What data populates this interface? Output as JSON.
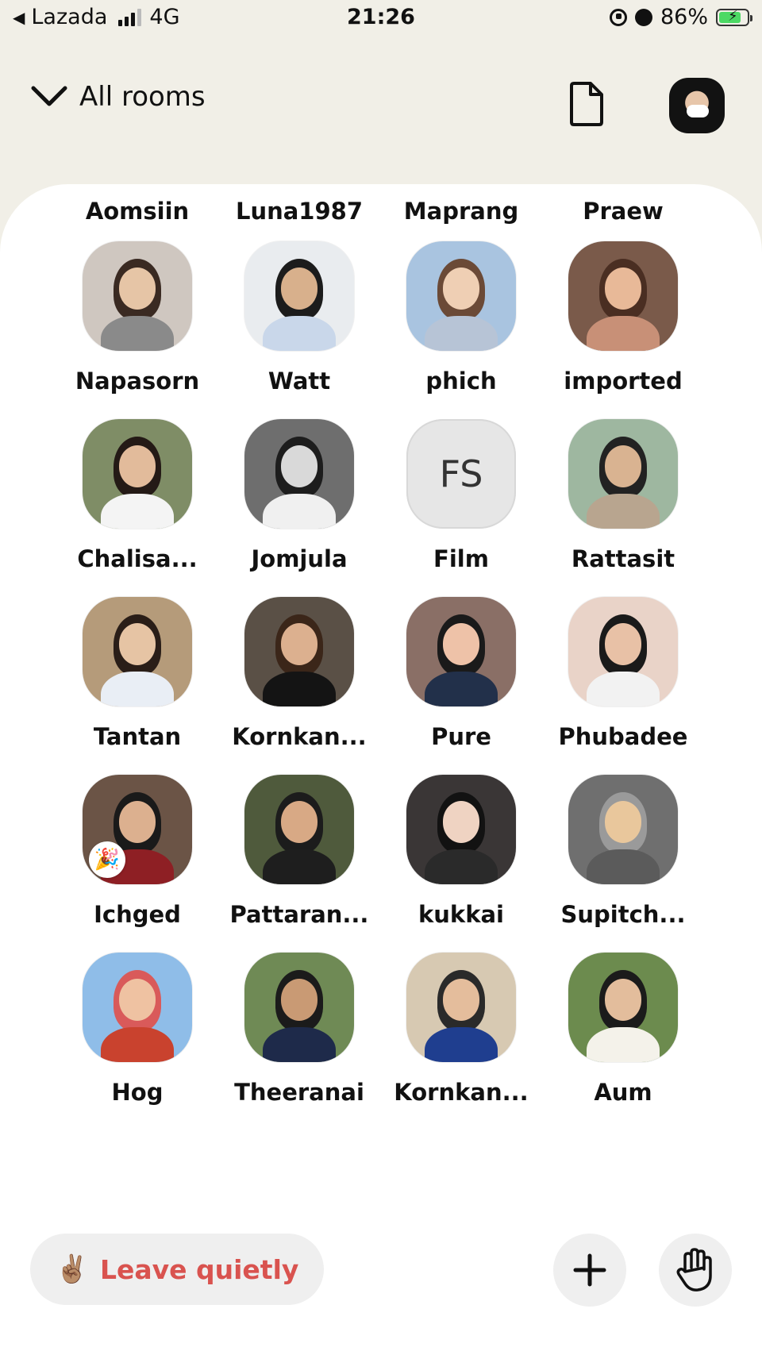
{
  "status_bar": {
    "carrier": "Lazada",
    "network": "4G",
    "time": "21:26",
    "battery": "86%"
  },
  "header": {
    "rooms_label": "All rooms"
  },
  "top_names": [
    "Aomsiin",
    "Luna1987",
    "Maprang",
    "Praew"
  ],
  "participants": [
    {
      "name": "Napasorn",
      "bg": "#cfc7c0",
      "skin": "#e6c5a6",
      "hair": "#3a2a22",
      "shirt": "#8a8a8a"
    },
    {
      "name": "Watt",
      "bg": "#e9ecef",
      "skin": "#d8b08c",
      "hair": "#1c1c1c",
      "shirt": "#c9d7ea"
    },
    {
      "name": "phich",
      "bg": "#a9c4e0",
      "skin": "#efcfb4",
      "hair": "#6b4a37",
      "shirt": "#b7c4d6"
    },
    {
      "name": "imported",
      "bg": "#7a5a4a",
      "skin": "#e8b998",
      "hair": "#4a2e22",
      "shirt": "#c89077"
    },
    {
      "name": "Chalisa...",
      "bg": "#7f8d66",
      "skin": "#e2bb9b",
      "hair": "#241a16",
      "shirt": "#f4f4f4"
    },
    {
      "name": "Jomjula",
      "bg": "#6e6e6e",
      "skin": "#d9d9d9",
      "hair": "#1d1d1d",
      "shirt": "#f0f0f0"
    },
    {
      "name": "Film",
      "initials": "FS"
    },
    {
      "name": "Rattasit",
      "bg": "#9eb7a0",
      "skin": "#d9b391",
      "hair": "#222222",
      "shirt": "#b8a58f"
    },
    {
      "name": "Tantan",
      "bg": "#b59b7a",
      "skin": "#e6c4a4",
      "hair": "#2a1e18",
      "shirt": "#e9eef5"
    },
    {
      "name": "Kornkan...",
      "bg": "#5a5046",
      "skin": "#dcb08f",
      "hair": "#3b2619",
      "shirt": "#141414"
    },
    {
      "name": "Pure",
      "bg": "#8a6f66",
      "skin": "#eec2a8",
      "hair": "#1a1a1a",
      "shirt": "#22304a"
    },
    {
      "name": "Phubadee",
      "bg": "#e9d3c8",
      "skin": "#e8c1a6",
      "hair": "#1a1a1a",
      "shirt": "#f2f2f2"
    },
    {
      "name": "Ichged",
      "bg": "#6b5446",
      "skin": "#dcb08f",
      "hair": "#1a1a1a",
      "shirt": "#8e1f24",
      "badge": "🎉"
    },
    {
      "name": "Pattaran...",
      "bg": "#4f5a3c",
      "skin": "#d8a985",
      "hair": "#1c1c1c",
      "shirt": "#1e1e1e"
    },
    {
      "name": "kukkai",
      "bg": "#3a3636",
      "skin": "#efd3c2",
      "hair": "#121212",
      "shirt": "#2a2a2a"
    },
    {
      "name": "Supitch...",
      "bg": "#6f6f6f",
      "skin": "#e9c79c",
      "hair": "#9a9a9a",
      "shirt": "#5b5b5b"
    },
    {
      "name": "Hog",
      "bg": "#8fbde8",
      "skin": "#efc2a2",
      "hair": "#d95a5a",
      "shirt": "#c9422e"
    },
    {
      "name": "Theeranai",
      "bg": "#6f8a55",
      "skin": "#c99a74",
      "hair": "#1b1b1b",
      "shirt": "#1e2a4a"
    },
    {
      "name": "Kornkan...",
      "bg": "#d7c9b2",
      "skin": "#e4bd9c",
      "hair": "#2a2a2a",
      "shirt": "#1f3e8f"
    },
    {
      "name": "Aum",
      "bg": "#6c8b4e",
      "skin": "#e3bd9c",
      "hair": "#1b1b1b",
      "shirt": "#f4f2ea"
    }
  ],
  "bottom_bar": {
    "leave_emoji": "✌🏽",
    "leave_label": "Leave quietly"
  },
  "colors": {
    "header_bg": "#f1efe7",
    "leave_text": "#d9534f",
    "button_bg": "#efefef"
  }
}
